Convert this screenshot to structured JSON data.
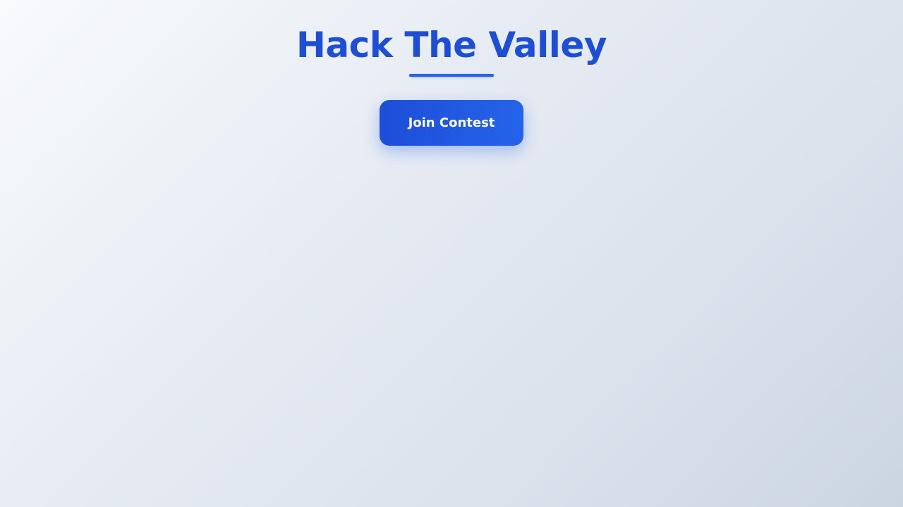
{
  "header": {
    "title": "Hack The Valley"
  },
  "actions": {
    "join_label": "Join Contest"
  },
  "colors": {
    "accent": "#1d4ed8",
    "accent_light": "#2563eb",
    "background_start": "#f8fafc",
    "background_end": "#cbd5e1"
  }
}
